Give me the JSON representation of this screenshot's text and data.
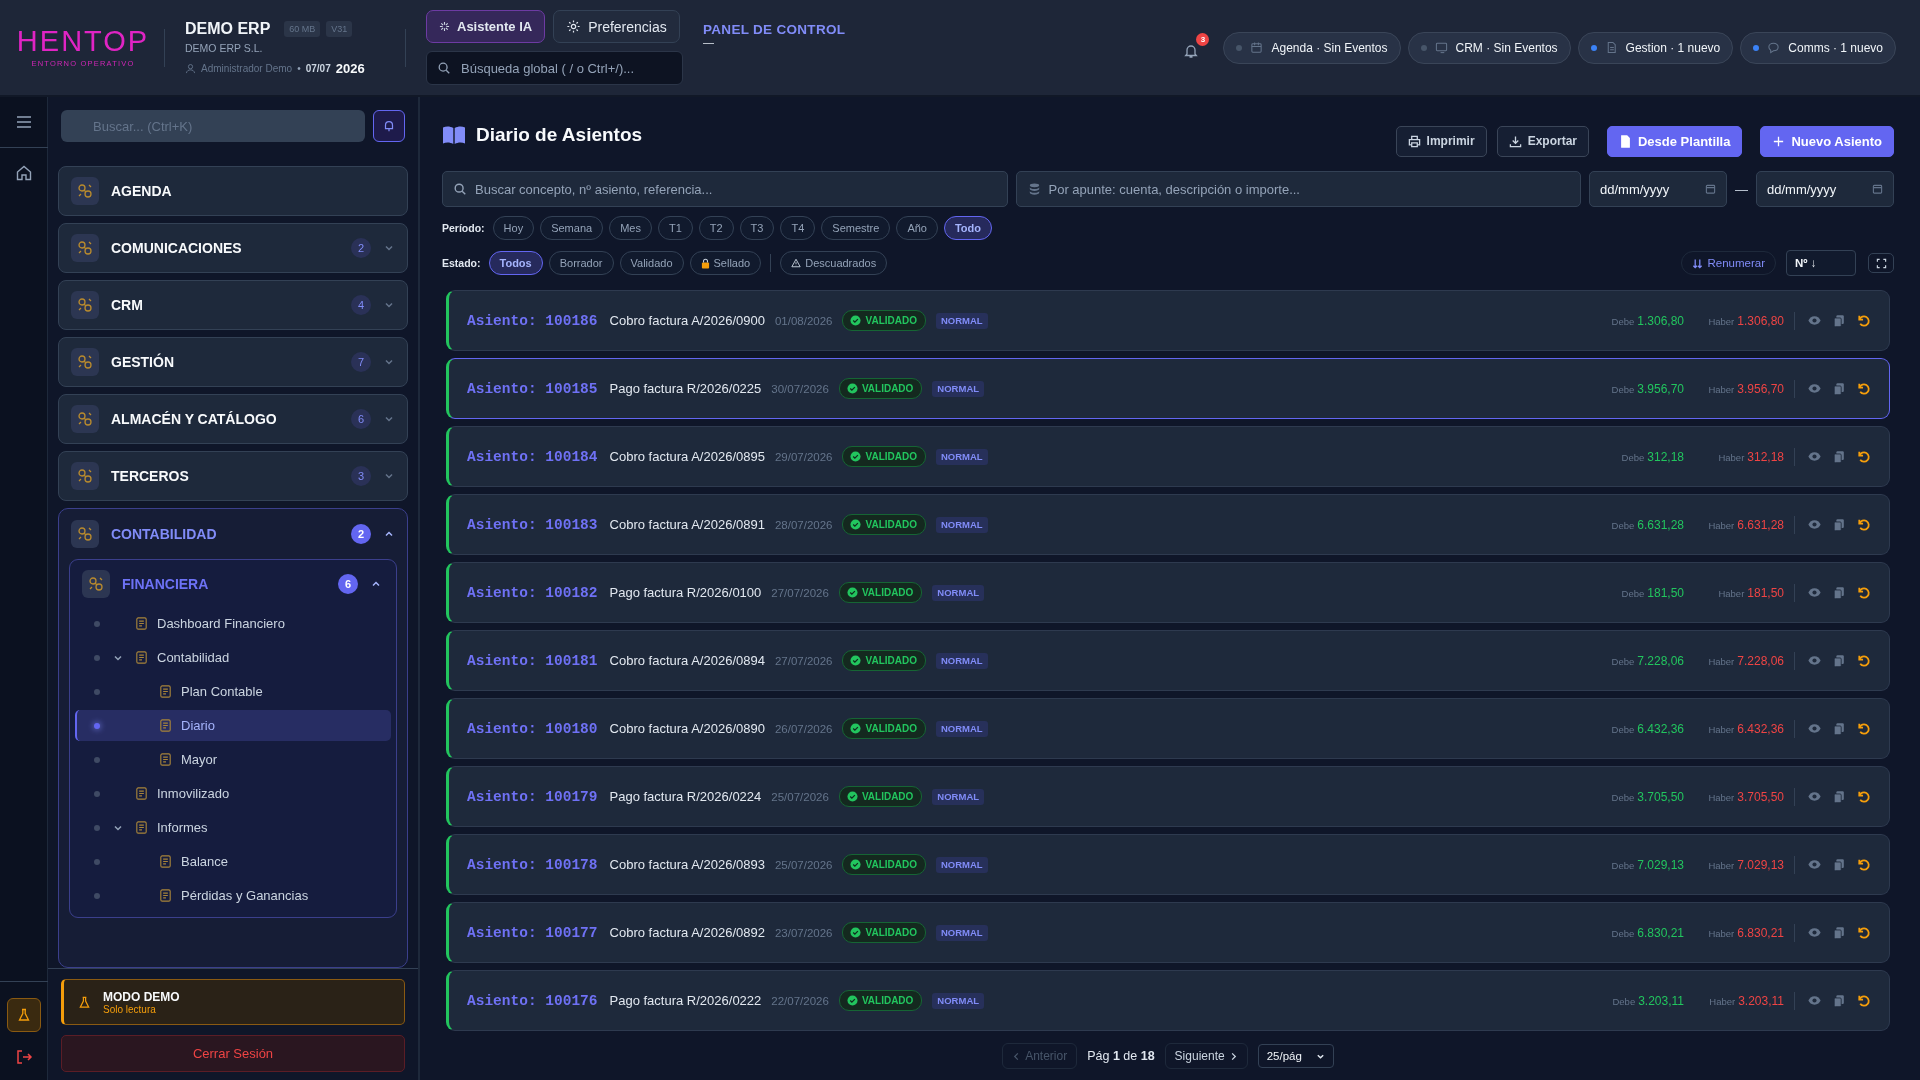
{
  "header": {
    "logo": {
      "name": "HENTOP",
      "tagline": "ENTORNO OPERATIVO"
    },
    "app_name": "DEMO ERP",
    "badges": [
      "60 MB",
      "V31"
    ],
    "company": "DEMO ERP S.L.",
    "user": "Administrador Demo",
    "separator": "•",
    "date": "07/07",
    "year": "2026",
    "buttons": [
      {
        "label": "Asistente IA",
        "selected": true
      },
      {
        "label": "Preferencias",
        "selected": false
      }
    ],
    "search": {
      "placeholder": "Búsqueda global ( / o Ctrl+/)..."
    },
    "breadcrumb": {
      "title": "PANEL DE CONTROL",
      "subtitle": "—"
    },
    "notifications": {
      "count": "3"
    },
    "status_pills": [
      {
        "label": "Agenda · Sin Eventos",
        "color": "#475569"
      },
      {
        "label": "CRM · Sin Eventos",
        "color": "#475569"
      },
      {
        "label": "Gestion · 1 nuevo",
        "color": "#3b82f6"
      },
      {
        "label": "Comms · 1 nuevo",
        "color": "#3b82f6"
      }
    ]
  },
  "sidebar": {
    "search": {
      "placeholder": "Buscar... (Ctrl+K)"
    },
    "modules": [
      {
        "label": "AGENDA"
      },
      {
        "label": "COMUNICACIONES",
        "count": "2",
        "expanded": false
      },
      {
        "label": "CRM",
        "count": "4",
        "expanded": false
      },
      {
        "label": "GESTIÓN",
        "count": "7",
        "expanded": false
      },
      {
        "label": "ALMACÉN Y CATÁLOGO",
        "count": "6",
        "expanded": false
      },
      {
        "label": "TERCEROS",
        "count": "3",
        "expanded": false
      },
      {
        "label": "CONTABILIDAD",
        "count": "2",
        "expanded": true,
        "children": [
          {
            "label": "FINANCIERA",
            "count": "6",
            "expanded": true,
            "children": [
              {
                "label": "Dashboard Financiero",
                "selected": false
              },
              {
                "label": "Contabilidad",
                "selected": false,
                "expanded": true,
                "children": [
                  {
                    "label": "Plan Contable",
                    "selected": false
                  },
                  {
                    "label": "Diario",
                    "selected": true
                  },
                  {
                    "label": "Mayor",
                    "selected": false
                  }
                ]
              },
              {
                "label": "Inmovilizado",
                "selected": false
              },
              {
                "label": "Informes",
                "selected": false,
                "expanded": true,
                "children": [
                  {
                    "label": "Balance",
                    "selected": false
                  },
                  {
                    "label": "Pérdidas y Ganancias",
                    "selected": false
                  }
                ]
              }
            ]
          }
        ]
      }
    ],
    "demo": {
      "title": "MODO DEMO",
      "subtitle": "Solo lectura"
    },
    "logout": "Cerrar Sesión"
  },
  "main": {
    "title": "Diario de Asientos",
    "actions": [
      {
        "label": "Imprimir",
        "kind": "secondary"
      },
      {
        "label": "Exportar",
        "kind": "secondary"
      },
      {
        "label": "Desde Plantilla",
        "kind": "primary"
      },
      {
        "label": "Nuevo Asiento",
        "kind": "primary"
      }
    ],
    "search": {
      "placeholder": "Buscar concepto, nº asiento, referencia..."
    },
    "line_search": {
      "placeholder": "Por apunte: cuenta, descripción o importe..."
    },
    "date_from": {
      "placeholder": "dd/mm/yyyy"
    },
    "date_separator": "—",
    "date_to": {
      "placeholder": "dd/mm/yyyy"
    },
    "period": {
      "label": "Período:",
      "options": [
        {
          "label": "Hoy",
          "selected": false
        },
        {
          "label": "Semana",
          "selected": false
        },
        {
          "label": "Mes",
          "selected": false
        },
        {
          "label": "T1",
          "selected": false
        },
        {
          "label": "T2",
          "selected": false
        },
        {
          "label": "T3",
          "selected": false
        },
        {
          "label": "T4",
          "selected": false
        },
        {
          "label": "Semestre",
          "selected": false
        },
        {
          "label": "Año",
          "selected": false
        },
        {
          "label": "Todo",
          "selected": true
        }
      ]
    },
    "status_filter": {
      "label": "Estado:",
      "options": [
        {
          "label": "Todos",
          "selected": true
        },
        {
          "label": "Borrador",
          "selected": false
        },
        {
          "label": "Validado",
          "selected": false
        },
        {
          "label": "Sellado",
          "selected": false,
          "kind": "locked"
        },
        {
          "label": "Descuadrados",
          "selected": false,
          "kind": "warning"
        }
      ]
    },
    "renumber": "Renumerar",
    "sort": {
      "value": "Nº ↓"
    },
    "entries": [
      {
        "number": "Asiento: 100186",
        "description": "Cobro factura A/2026/0900",
        "date": "01/08/2026",
        "status": "VALIDADO",
        "type": "NORMAL",
        "debit_label": "Debe",
        "debit": "1.306,80",
        "credit_label": "Haber",
        "credit": "1.306,80",
        "selected": false
      },
      {
        "number": "Asiento: 100185",
        "description": "Pago factura R/2026/0225",
        "date": "30/07/2026",
        "status": "VALIDADO",
        "type": "NORMAL",
        "debit_label": "Debe",
        "debit": "3.956,70",
        "credit_label": "Haber",
        "credit": "3.956,70",
        "selected": true
      },
      {
        "number": "Asiento: 100184",
        "description": "Cobro factura A/2026/0895",
        "date": "29/07/2026",
        "status": "VALIDADO",
        "type": "NORMAL",
        "debit_label": "Debe",
        "debit": "312,18",
        "credit_label": "Haber",
        "credit": "312,18",
        "selected": false
      },
      {
        "number": "Asiento: 100183",
        "description": "Cobro factura A/2026/0891",
        "date": "28/07/2026",
        "status": "VALIDADO",
        "type": "NORMAL",
        "debit_label": "Debe",
        "debit": "6.631,28",
        "credit_label": "Haber",
        "credit": "6.631,28",
        "selected": false
      },
      {
        "number": "Asiento: 100182",
        "description": "Pago factura R/2026/0100",
        "date": "27/07/2026",
        "status": "VALIDADO",
        "type": "NORMAL",
        "debit_label": "Debe",
        "debit": "181,50",
        "credit_label": "Haber",
        "credit": "181,50",
        "selected": false
      },
      {
        "number": "Asiento: 100181",
        "description": "Cobro factura A/2026/0894",
        "date": "27/07/2026",
        "status": "VALIDADO",
        "type": "NORMAL",
        "debit_label": "Debe",
        "debit": "7.228,06",
        "credit_label": "Haber",
        "credit": "7.228,06",
        "selected": false
      },
      {
        "number": "Asiento: 100180",
        "description": "Cobro factura A/2026/0890",
        "date": "26/07/2026",
        "status": "VALIDADO",
        "type": "NORMAL",
        "debit_label": "Debe",
        "debit": "6.432,36",
        "credit_label": "Haber",
        "credit": "6.432,36",
        "selected": false
      },
      {
        "number": "Asiento: 100179",
        "description": "Pago factura R/2026/0224",
        "date": "25/07/2026",
        "status": "VALIDADO",
        "type": "NORMAL",
        "debit_label": "Debe",
        "debit": "3.705,50",
        "credit_label": "Haber",
        "credit": "3.705,50",
        "selected": false
      },
      {
        "number": "Asiento: 100178",
        "description": "Cobro factura A/2026/0893",
        "date": "25/07/2026",
        "status": "VALIDADO",
        "type": "NORMAL",
        "debit_label": "Debe",
        "debit": "7.029,13",
        "credit_label": "Haber",
        "credit": "7.029,13",
        "selected": false
      },
      {
        "number": "Asiento: 100177",
        "description": "Cobro factura A/2026/0892",
        "date": "23/07/2026",
        "status": "VALIDADO",
        "type": "NORMAL",
        "debit_label": "Debe",
        "debit": "6.830,21",
        "credit_label": "Haber",
        "credit": "6.830,21",
        "selected": false
      },
      {
        "number": "Asiento: 100176",
        "description": "Pago factura R/2026/0222",
        "date": "22/07/2026",
        "status": "VALIDADO",
        "type": "NORMAL",
        "debit_label": "Debe",
        "debit": "3.203,11",
        "credit_label": "Haber",
        "credit": "3.203,11",
        "selected": false
      }
    ],
    "pagination": {
      "previous": {
        "label": "Anterior",
        "disabled": true
      },
      "page": "Pág **1** de **18**",
      "next": {
        "label": "Siguiente",
        "disabled": false
      },
      "page_size": "25/pág"
    }
  }
}
